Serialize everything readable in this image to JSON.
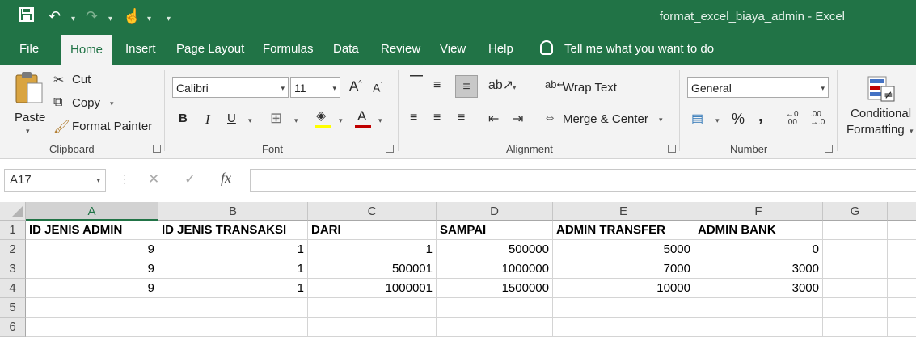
{
  "window": {
    "title": "format_excel_biaya_admin  -  Excel"
  },
  "tabs": [
    {
      "label": "File"
    },
    {
      "label": "Home"
    },
    {
      "label": "Insert"
    },
    {
      "label": "Page Layout"
    },
    {
      "label": "Formulas"
    },
    {
      "label": "Data"
    },
    {
      "label": "Review"
    },
    {
      "label": "View"
    },
    {
      "label": "Help"
    }
  ],
  "tellme": "Tell me what you want to do",
  "clipboard": {
    "paste": "Paste",
    "cut": "Cut",
    "copy": "Copy",
    "format_painter": "Format Painter",
    "label": "Clipboard"
  },
  "font": {
    "name": "Calibri",
    "size": "11",
    "label": "Font",
    "bold": "B",
    "italic": "I",
    "underline": "U",
    "grow": "A",
    "shrink": "A",
    "highlight_color": "#ffff00",
    "font_color": "#c00000"
  },
  "alignment": {
    "wrap": "Wrap Text",
    "merge": "Merge & Center",
    "label": "Alignment"
  },
  "number": {
    "format": "General",
    "label": "Number",
    "percent": "%",
    "comma": ","
  },
  "styles": {
    "conditional_line1": "Conditional",
    "conditional_line2": "Formatting"
  },
  "formula_bar": {
    "name_box": "A17",
    "fx": "fx",
    "cancel": "✕",
    "enter": "✓"
  },
  "sheet": {
    "columns": [
      "A",
      "B",
      "C",
      "D",
      "E",
      "F",
      "G"
    ],
    "rows": [
      "1",
      "2",
      "3",
      "4",
      "5",
      "6"
    ],
    "cells": [
      [
        "ID JENIS ADMIN",
        "ID JENIS TRANSAKSI",
        "DARI",
        "SAMPAI",
        "ADMIN TRANSFER",
        "ADMIN BANK",
        ""
      ],
      [
        "9",
        "1",
        "1",
        "500000",
        "5000",
        "0",
        ""
      ],
      [
        "9",
        "1",
        "500001",
        "1000000",
        "7000",
        "3000",
        ""
      ],
      [
        "9",
        "1",
        "1000001",
        "1500000",
        "10000",
        "3000",
        ""
      ],
      [
        "",
        "",
        "",
        "",
        "",
        "",
        ""
      ],
      [
        "",
        "",
        "",
        "",
        "",
        "",
        ""
      ]
    ]
  }
}
